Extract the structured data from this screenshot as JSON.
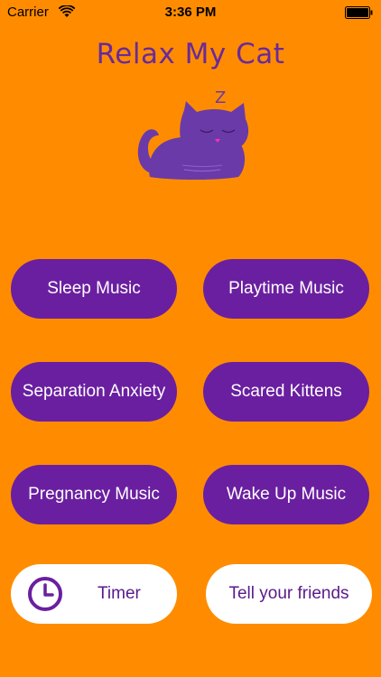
{
  "status_bar": {
    "carrier": "Carrier",
    "time": "3:36 PM"
  },
  "app": {
    "title": "Relax My Cat",
    "sleep_mark": "Z"
  },
  "buttons": {
    "sleep_music": "Sleep Music",
    "playtime_music": "Playtime Music",
    "separation_anxiety": "Separation Anxiety",
    "scared_kittens": "Scared Kittens",
    "pregnancy_music": "Pregnancy Music",
    "wake_up_music": "Wake Up Music",
    "timer": "Timer",
    "tell_friends": "Tell your friends"
  },
  "colors": {
    "background": "#FF8C00",
    "button_purple": "#6A1FA0",
    "title_purple": "#6A2A9A",
    "cat_purple": "#6A3AA8"
  },
  "icons": {
    "wifi": "wifi-icon",
    "battery": "battery-icon",
    "timer": "clock-icon",
    "logo": "sleeping-cat-icon"
  }
}
